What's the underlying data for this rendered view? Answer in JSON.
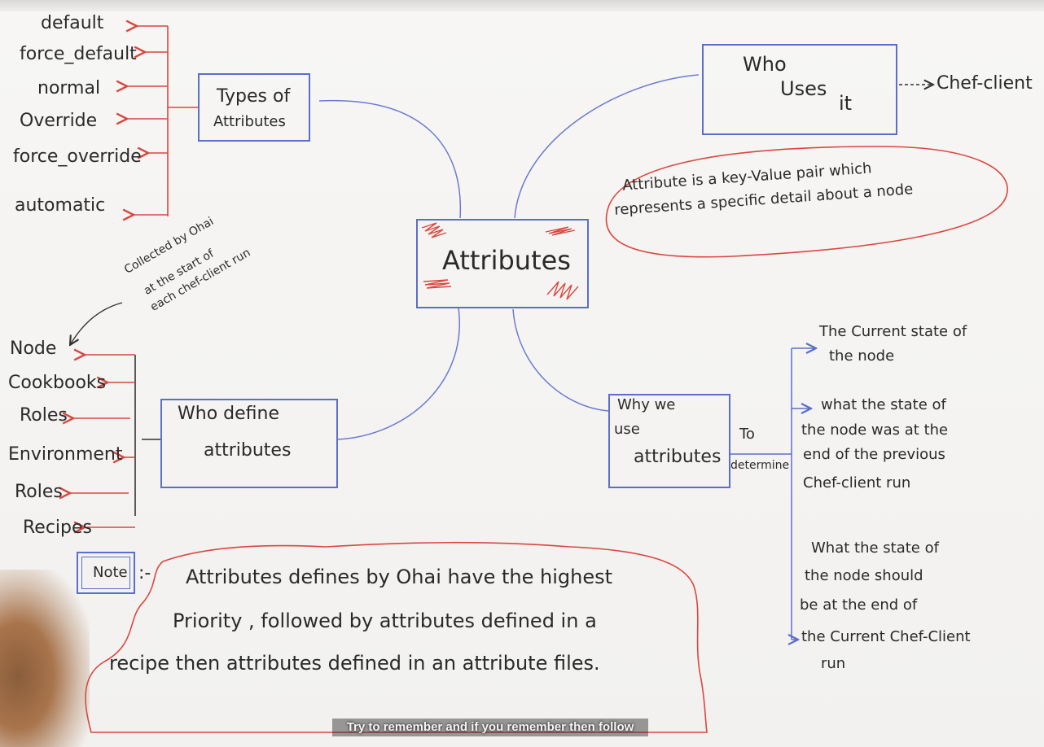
{
  "center": {
    "label": "Attributes"
  },
  "types": {
    "box_line1": "Types of",
    "box_line2": "Attributes",
    "items": [
      "default",
      "force_default",
      "normal",
      "Override",
      "force_override",
      "automatic"
    ]
  },
  "who_uses": {
    "box_line1": "Who",
    "box_line2": "Uses",
    "box_line3": "it",
    "target": "Chef-client"
  },
  "definition": {
    "line1": "Attribute is a key-Value pair which",
    "line2": "represents a specific detail about a node"
  },
  "who_define": {
    "box_line1": "Who define",
    "box_line2": "attributes",
    "items": [
      "Node",
      "Cookbooks",
      "Roles",
      "Environment",
      "Roles",
      "Recipes"
    ],
    "ohai_note_line1": "Collected by Ohai",
    "ohai_note_line2": "at the start of",
    "ohai_note_line3": "each chef-client run"
  },
  "why_use": {
    "box_line1": "Why we",
    "box_line2": "use",
    "box_line3": "attributes",
    "connector_top": "To",
    "connector_bottom": "determine",
    "reason1_line1": "The Current state of",
    "reason1_line2": "the node",
    "reason2_line1": "what the state of",
    "reason2_line2": "the node was at the",
    "reason2_line3": "end of the previous",
    "reason2_line4": "Chef-client run",
    "reason3_line1": "What the state of",
    "reason3_line2": "the node should",
    "reason3_line3": "be at the end of",
    "reason3_line4": "the Current Chef-Client",
    "reason3_line5": "run"
  },
  "note": {
    "label": "Note",
    "sep": ":-",
    "line1": "Attributes defines by Ohai have the highest",
    "line2": "Priority , followed by attributes defined in a",
    "line3": "recipe then attributes defined in an attribute files."
  },
  "caption": "Try to remember and if you remember then follow",
  "colors": {
    "box_blue": "#5b6ec9",
    "arrow_red": "#d9473f",
    "ink": "#2a2a2a"
  }
}
